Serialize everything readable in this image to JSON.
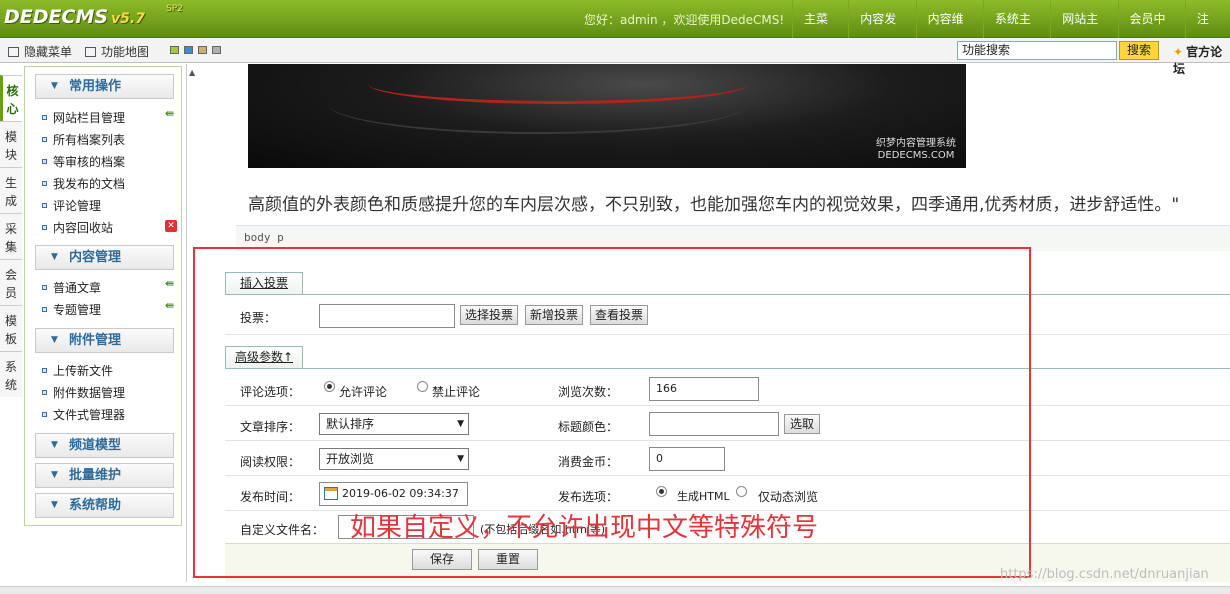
{
  "header": {
    "logo": "DEDECMS",
    "version": "v5.7",
    "version_tag": "SP2",
    "welcome": "您好：admin ，欢迎使用DedeCMS!",
    "nav": [
      "主菜单",
      "内容发布",
      "内容维护",
      "系统主页",
      "网站主页",
      "会员中心",
      "注销"
    ]
  },
  "toolbar": {
    "hide_menu": "隐藏菜单",
    "function_map": "功能地图",
    "skin_colors": [
      "#a6c83a",
      "#3a8fd0",
      "#c8b07a",
      "#b0b0b0"
    ],
    "search_value": "功能搜索",
    "search_button": "搜索",
    "forum_link": "官方论坛"
  },
  "left_tabs": [
    "核心",
    "模块",
    "生成",
    "采集",
    "会员",
    "模板",
    "系统"
  ],
  "sidebar": {
    "groups": [
      {
        "title": "常用操作",
        "items": [
          "网站栏目管理",
          "所有档案列表",
          "等审核的档案",
          "我发布的文档",
          "评论管理",
          "内容回收站"
        ]
      },
      {
        "title": "内容管理",
        "items": [
          "普通文章",
          "专题管理"
        ]
      },
      {
        "title": "附件管理",
        "items": [
          "上传新文件",
          "附件数据管理",
          "文件式管理器"
        ]
      },
      {
        "title": "频道模型",
        "items": []
      },
      {
        "title": "批量维护",
        "items": []
      },
      {
        "title": "系统帮助",
        "items": []
      }
    ]
  },
  "editor": {
    "image_watermark_line1": "织梦内容管理系统",
    "image_watermark_line2": "DEDECMS.COM",
    "body_text": "高颜值的外表颜色和质感提升您的车内层次感，不只别致，也能加强您车内的视觉效果，四季通用,优秀材质，进步舒适性。\"",
    "path": "body  p"
  },
  "vote": {
    "tab_label": "插入投票",
    "label": "投票：",
    "value": "",
    "buttons": [
      "选择投票",
      "新增投票",
      "查看投票"
    ]
  },
  "advanced": {
    "tab_label": "高级参数↑",
    "comment_label": "评论选项：",
    "comment_options": [
      "允许评论",
      "禁止评论"
    ],
    "views_label": "浏览次数：",
    "views_value": "166",
    "sort_label": "文章排序：",
    "sort_value": "默认排序",
    "title_color_label": "标题颜色：",
    "title_color_value": "",
    "pick_button": "选取",
    "read_perm_label": "阅读权限：",
    "read_perm_value": "开放浏览",
    "cost_label": "消费金币：",
    "cost_value": "0",
    "pubtime_label": "发布时间：",
    "pubtime_value": "2019-06-02 09:34:37",
    "publish_label": "发布选项：",
    "publish_options": [
      "生成HTML",
      "仅动态浏览"
    ],
    "filename_label": "自定义文件名：",
    "filename_value": "",
    "filename_hint": "(不包括后缀名如.html等)"
  },
  "actions": {
    "save": "保存",
    "reset": "重置"
  },
  "annotation": "如果自定义，不允许出现中文等特殊符号",
  "watermark": "https://blog.csdn.net/dnruanjian",
  "colors": {
    "brand_green": "#6a9c1e",
    "annotation_red": "#e5343b"
  }
}
